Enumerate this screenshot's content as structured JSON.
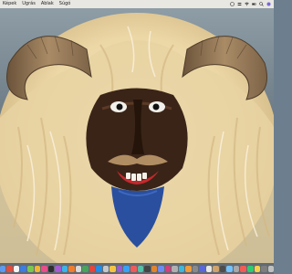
{
  "menubar": {
    "items": [
      {
        "label": "Képek"
      },
      {
        "label": "Ugrás"
      },
      {
        "label": "Ablak"
      },
      {
        "label": "Súgó"
      }
    ],
    "status_icons": [
      "help-icon",
      "control-center-icon",
      "wifi-icon",
      "battery-icon",
      "search-icon",
      "siri-icon"
    ]
  },
  "desktop": {
    "wallpaper": "busó-mask-photo"
  },
  "dock": {
    "app_colors": [
      "#5b9bf0",
      "#e24c3c",
      "#f4f4f4",
      "#3b7de0",
      "#7ac74f",
      "#f2b632",
      "#e94d8a",
      "#2f2f2f",
      "#a65bd3",
      "#3bb4e8",
      "#f07d2e",
      "#d9d9d9",
      "#4aa35a",
      "#e8443a",
      "#1f8ce8",
      "#c7c7c7",
      "#f5c542",
      "#9c59d1",
      "#36a3f5",
      "#ef5b5b",
      "#55c0a8",
      "#444444",
      "#e0852d",
      "#6b8cf2",
      "#d63d7a",
      "#b0b0b0",
      "#3db8d9",
      "#f09c38",
      "#8a8a8a",
      "#5a67d8",
      "#e6e6e6",
      "#cfa36b",
      "#4d4d4d",
      "#73c2fb",
      "#a8a8a8",
      "#f25c54",
      "#2ecc71",
      "#f6d14a",
      "#7e7e7e",
      "#c0c0c0"
    ]
  }
}
